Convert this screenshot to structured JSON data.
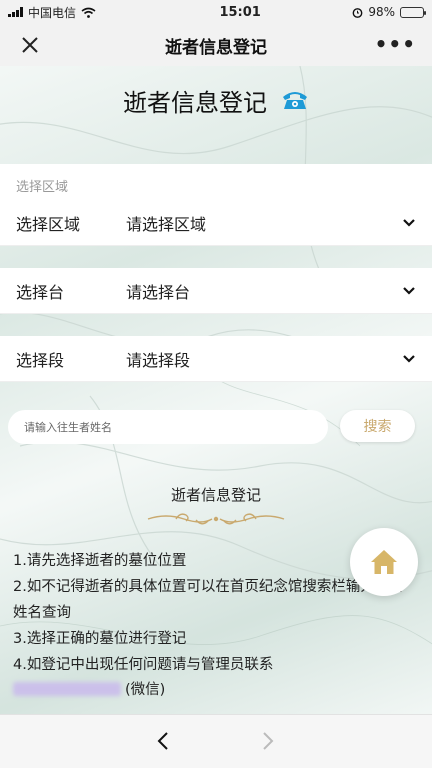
{
  "status_bar": {
    "carrier": "中国电信",
    "time": "15:01",
    "battery": "98%",
    "battery_level": 0.98
  },
  "nav": {
    "title": "逝者信息登记",
    "more": "•••"
  },
  "header": {
    "title": "逝者信息登记"
  },
  "selection": {
    "caption": "选择区域",
    "rows": [
      {
        "label": "选择区域",
        "value": "请选择区域"
      },
      {
        "label": "选择台",
        "value": "请选择台"
      },
      {
        "label": "选择段",
        "value": "请选择段"
      }
    ]
  },
  "search": {
    "placeholder": "请输入往生者姓名",
    "button_label": "搜索"
  },
  "info": {
    "title": "逝者信息登记",
    "lines": [
      "1.请先选择逝者的墓位位置",
      "2.如不记得逝者的具体位置可以在首页纪念馆搜索栏输入逝者姓名查询",
      "3.选择正确的墓位进行登记",
      "4.如登记中出现任何问题请与管理员联系"
    ],
    "contact_suffix": "(微信)"
  },
  "colors": {
    "accent_gold": "#c9a96e",
    "phone_icon_blue": "#1e9ad6"
  }
}
